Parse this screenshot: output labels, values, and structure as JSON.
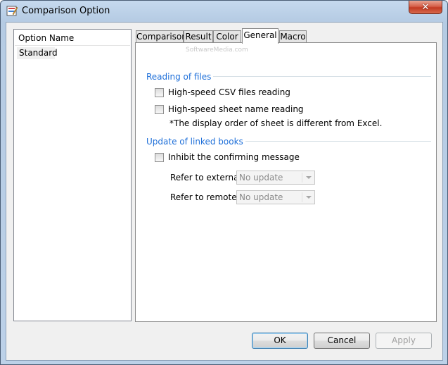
{
  "window": {
    "title": "Comparison Option",
    "close_glyph": "✕"
  },
  "list": {
    "header": "Option Name",
    "items": [
      {
        "label": "Standard"
      }
    ]
  },
  "tabs": [
    {
      "label": "Comparison"
    },
    {
      "label": "Result"
    },
    {
      "label": "Color"
    },
    {
      "label": "General",
      "active": true
    },
    {
      "label": "Macro"
    }
  ],
  "general": {
    "reading_group": {
      "title": "Reading of files",
      "csv_label": "High-speed CSV files reading",
      "csv_checked": false,
      "sheet_label": "High-speed sheet name reading",
      "sheet_checked": false,
      "note": "*The display order of sheet is different from Excel."
    },
    "update_group": {
      "title": "Update of linked books",
      "inhibit_label": "Inhibit the confirming message",
      "inhibit_checked": false,
      "external_label": "Refer to external",
      "external_value": "No update",
      "remote_label": "Refer to remote",
      "remote_value": "No update"
    }
  },
  "watermark": "SoftwareMedia.com",
  "buttons": {
    "ok": "OK",
    "cancel": "Cancel",
    "apply": "Apply"
  },
  "colors": {
    "group_title": "#1e6fd9",
    "close_red": "#c23a22"
  }
}
